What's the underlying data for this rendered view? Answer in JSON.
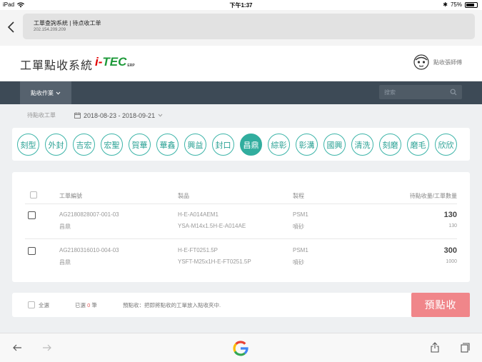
{
  "statusbar": {
    "device": "iPad",
    "time": "下午1:37",
    "battery": "75%",
    "battery_fraction": 0.75
  },
  "browser": {
    "page_title": "工單查詢系統 | 待点收工单",
    "url": "202.154.209.209"
  },
  "app": {
    "title": "工單點收系統",
    "logo_i": "i-",
    "logo_tec": "TEC",
    "logo_erp": "ERP",
    "user_name": "點收張師傅"
  },
  "nav": {
    "menu_label": "點收作業",
    "search_placeholder": "搜索"
  },
  "filter": {
    "label": "待點收工單",
    "date_range": "2018-08-23 - 2018-09-21"
  },
  "chips": [
    "刻型",
    "外封",
    "吉宏",
    "宏聖",
    "賀華",
    "華鑫",
    "興益",
    "封口",
    "昌鼎",
    "綜彰",
    "彰溝",
    "國興",
    "清洗",
    "刻磨",
    "磨毛",
    "欣欣"
  ],
  "active_chip": "昌鼎",
  "table": {
    "headers": {
      "order_no": "工單編號",
      "product": "製品",
      "process": "製程",
      "qty": "待點收量/工單數量"
    },
    "rows": [
      {
        "order_no": "AG2180828007-001-03",
        "vendor": "昌鼎",
        "product": "H-E-A014AEM1",
        "product_spec": "YSA-M14x1.5H-E-A014AE",
        "process": "PSM1",
        "process_sub": "噴砂",
        "pending": "130",
        "total": "130"
      },
      {
        "order_no": "AG2180316010-004-03",
        "vendor": "昌鼎",
        "product": "H-E-FT0251.5P",
        "product_spec": "YSFT-M25x1H-E-FT0251.5P",
        "process": "PSM1",
        "process_sub": "噴砂",
        "pending": "300",
        "total": "1000"
      }
    ]
  },
  "footer": {
    "select_all": "全選",
    "selected_prefix": "已選",
    "selected_count": "0",
    "selected_suffix": "筆",
    "hint": "預點收：把即將點收的工單放入點收夾中.",
    "pre_receive_button": "預點收"
  },
  "colors": {
    "accent": "#31ad9e",
    "nav": "#3d4a56",
    "button": "#f0868a",
    "logo_red": "#e30000",
    "logo_green": "#1e9a3a"
  }
}
